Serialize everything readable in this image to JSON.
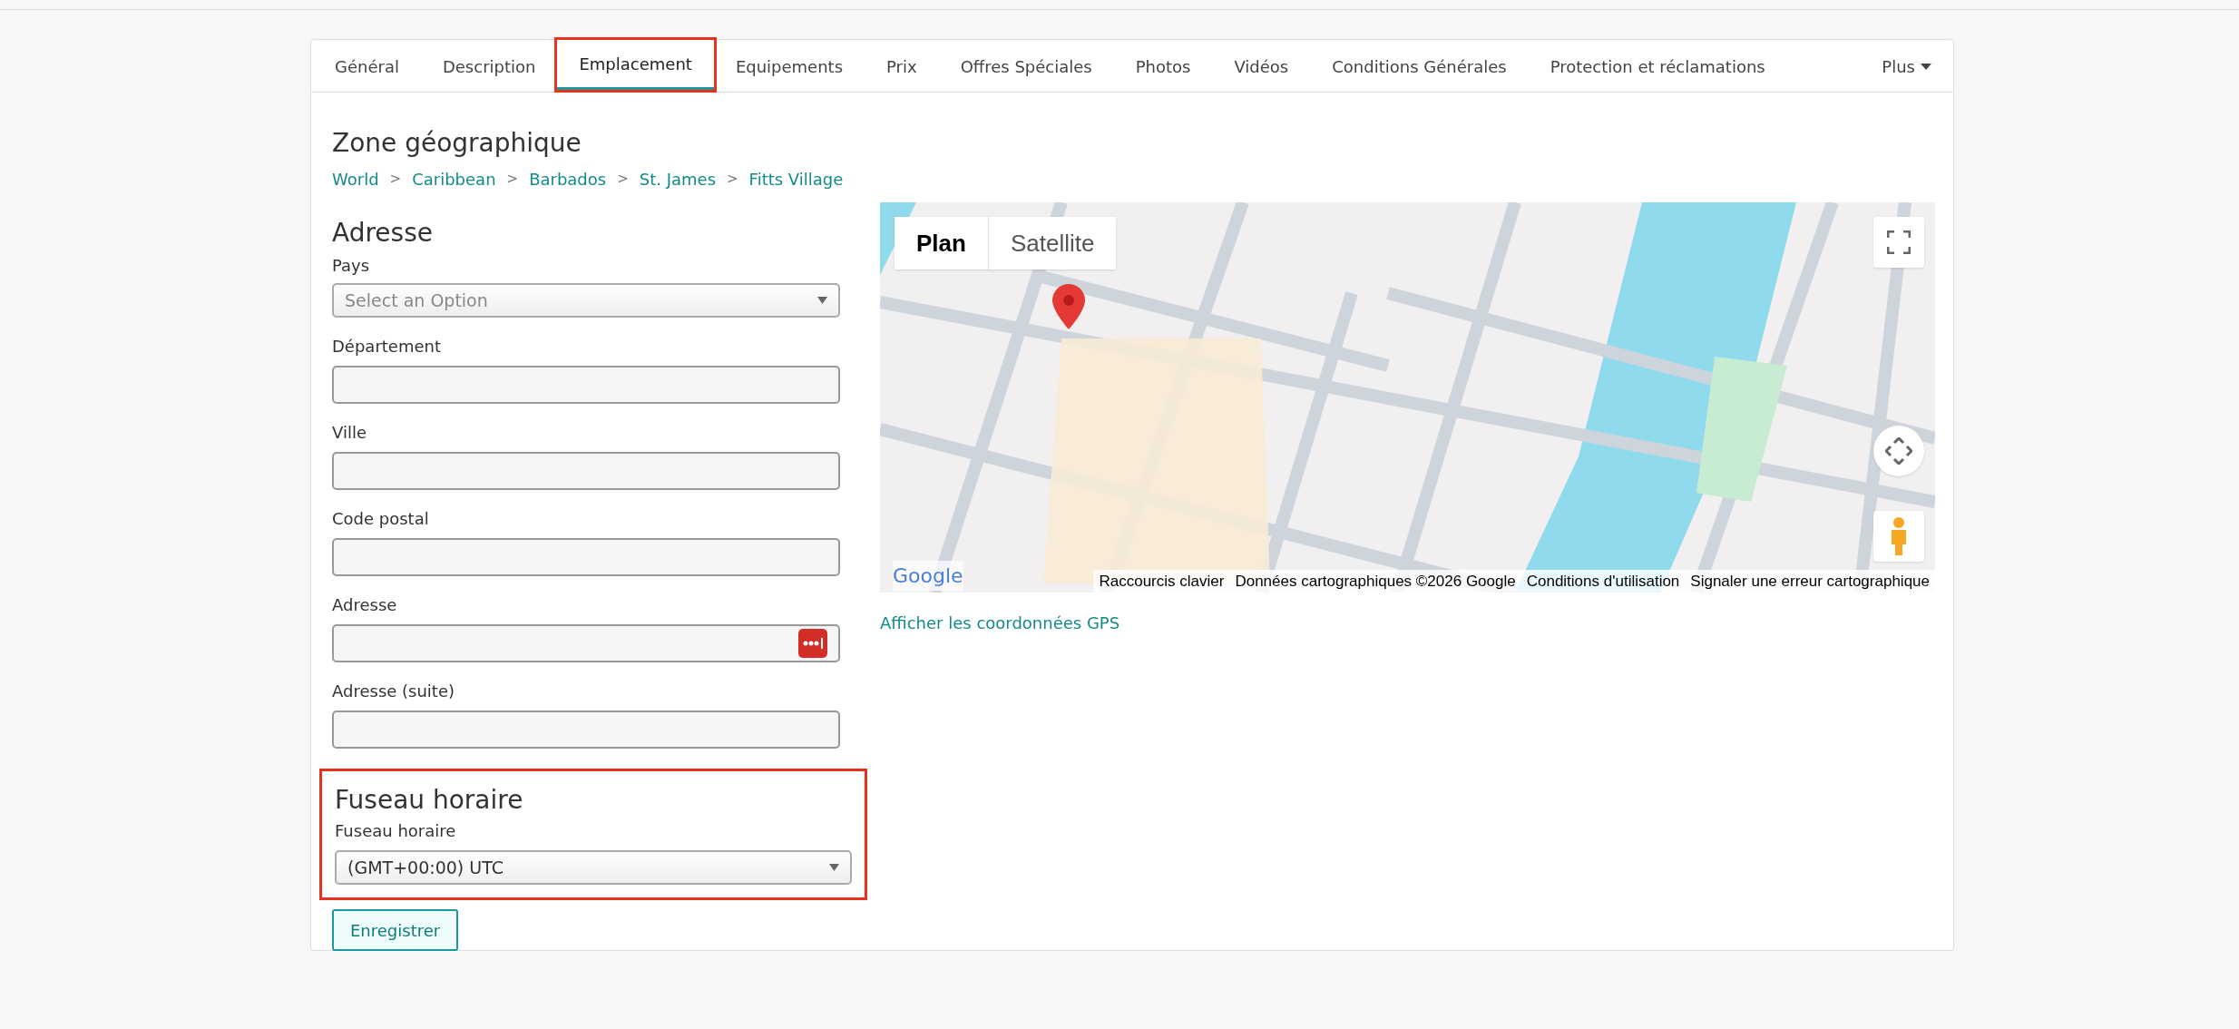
{
  "tabs": [
    {
      "label": "Général",
      "selected": false,
      "highlighted": false
    },
    {
      "label": "Description",
      "selected": false,
      "highlighted": false
    },
    {
      "label": "Emplacement",
      "selected": true,
      "highlighted": true
    },
    {
      "label": "Equipements",
      "selected": false,
      "highlighted": false
    },
    {
      "label": "Prix",
      "selected": false,
      "highlighted": false
    },
    {
      "label": "Offres Spéciales",
      "selected": false,
      "highlighted": false
    },
    {
      "label": "Photos",
      "selected": false,
      "highlighted": false
    },
    {
      "label": "Vidéos",
      "selected": false,
      "highlighted": false
    },
    {
      "label": "Conditions Générales",
      "selected": false,
      "highlighted": false
    },
    {
      "label": "Protection et réclamations",
      "selected": false,
      "highlighted": false
    }
  ],
  "more_menu": {
    "label": "Plus"
  },
  "zone": {
    "title": "Zone géographique",
    "breadcrumb": [
      {
        "kind": "link",
        "text": "World"
      },
      {
        "kind": "separator",
        "text": ">"
      },
      {
        "kind": "link",
        "text": "Caribbean"
      },
      {
        "kind": "separator",
        "text": ">"
      },
      {
        "kind": "link",
        "text": "Barbados"
      },
      {
        "kind": "separator",
        "text": ">"
      },
      {
        "kind": "link",
        "text": "St. James"
      },
      {
        "kind": "separator",
        "text": ">"
      },
      {
        "kind": "link",
        "text": "Fitts Village"
      }
    ]
  },
  "address": {
    "title": "Adresse",
    "fields": [
      {
        "label": "Pays",
        "kind": "select",
        "placeholder": "Select an Option"
      },
      {
        "label": "Département",
        "kind": "text"
      },
      {
        "label": "Ville",
        "kind": "text"
      },
      {
        "label": "Code postal",
        "kind": "text"
      },
      {
        "label": "Adresse",
        "kind": "text",
        "autofill_icon": true
      },
      {
        "label": "Adresse (suite)",
        "kind": "text"
      }
    ]
  },
  "timezone": {
    "title": "Fuseau horaire",
    "label": "Fuseau horaire",
    "value": "(GMT+00:00) UTC",
    "highlighted": true
  },
  "save_button": "Enregistrer",
  "map": {
    "map_types": [
      {
        "label": "Plan",
        "selected": true
      },
      {
        "label": "Satellite",
        "selected": false
      }
    ],
    "logo": "Google",
    "attribution": [
      "Raccourcis clavier",
      "Données cartographiques ©2026 Google",
      "Conditions d'utilisation",
      "Signaler une erreur cartographique"
    ]
  },
  "gps_link": "Afficher les coordonnées GPS"
}
